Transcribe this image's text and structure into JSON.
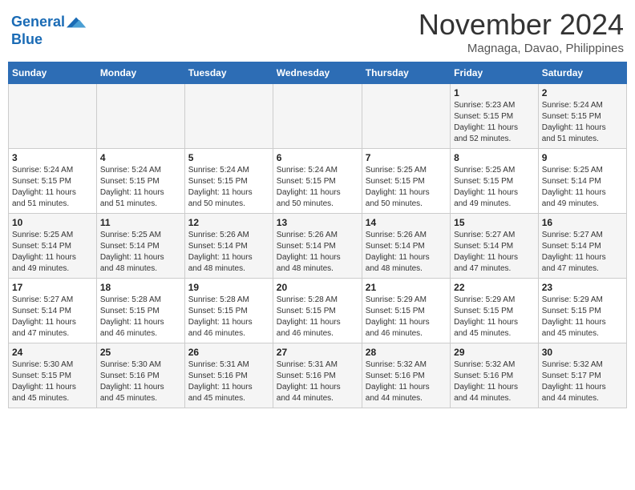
{
  "header": {
    "logo_line1": "General",
    "logo_line2": "Blue",
    "month": "November 2024",
    "location": "Magnaga, Davao, Philippines"
  },
  "weekdays": [
    "Sunday",
    "Monday",
    "Tuesday",
    "Wednesday",
    "Thursday",
    "Friday",
    "Saturday"
  ],
  "weeks": [
    [
      {
        "day": "",
        "info": ""
      },
      {
        "day": "",
        "info": ""
      },
      {
        "day": "",
        "info": ""
      },
      {
        "day": "",
        "info": ""
      },
      {
        "day": "",
        "info": ""
      },
      {
        "day": "1",
        "info": "Sunrise: 5:23 AM\nSunset: 5:15 PM\nDaylight: 11 hours\nand 52 minutes."
      },
      {
        "day": "2",
        "info": "Sunrise: 5:24 AM\nSunset: 5:15 PM\nDaylight: 11 hours\nand 51 minutes."
      }
    ],
    [
      {
        "day": "3",
        "info": "Sunrise: 5:24 AM\nSunset: 5:15 PM\nDaylight: 11 hours\nand 51 minutes."
      },
      {
        "day": "4",
        "info": "Sunrise: 5:24 AM\nSunset: 5:15 PM\nDaylight: 11 hours\nand 51 minutes."
      },
      {
        "day": "5",
        "info": "Sunrise: 5:24 AM\nSunset: 5:15 PM\nDaylight: 11 hours\nand 50 minutes."
      },
      {
        "day": "6",
        "info": "Sunrise: 5:24 AM\nSunset: 5:15 PM\nDaylight: 11 hours\nand 50 minutes."
      },
      {
        "day": "7",
        "info": "Sunrise: 5:25 AM\nSunset: 5:15 PM\nDaylight: 11 hours\nand 50 minutes."
      },
      {
        "day": "8",
        "info": "Sunrise: 5:25 AM\nSunset: 5:15 PM\nDaylight: 11 hours\nand 49 minutes."
      },
      {
        "day": "9",
        "info": "Sunrise: 5:25 AM\nSunset: 5:14 PM\nDaylight: 11 hours\nand 49 minutes."
      }
    ],
    [
      {
        "day": "10",
        "info": "Sunrise: 5:25 AM\nSunset: 5:14 PM\nDaylight: 11 hours\nand 49 minutes."
      },
      {
        "day": "11",
        "info": "Sunrise: 5:25 AM\nSunset: 5:14 PM\nDaylight: 11 hours\nand 48 minutes."
      },
      {
        "day": "12",
        "info": "Sunrise: 5:26 AM\nSunset: 5:14 PM\nDaylight: 11 hours\nand 48 minutes."
      },
      {
        "day": "13",
        "info": "Sunrise: 5:26 AM\nSunset: 5:14 PM\nDaylight: 11 hours\nand 48 minutes."
      },
      {
        "day": "14",
        "info": "Sunrise: 5:26 AM\nSunset: 5:14 PM\nDaylight: 11 hours\nand 48 minutes."
      },
      {
        "day": "15",
        "info": "Sunrise: 5:27 AM\nSunset: 5:14 PM\nDaylight: 11 hours\nand 47 minutes."
      },
      {
        "day": "16",
        "info": "Sunrise: 5:27 AM\nSunset: 5:14 PM\nDaylight: 11 hours\nand 47 minutes."
      }
    ],
    [
      {
        "day": "17",
        "info": "Sunrise: 5:27 AM\nSunset: 5:14 PM\nDaylight: 11 hours\nand 47 minutes."
      },
      {
        "day": "18",
        "info": "Sunrise: 5:28 AM\nSunset: 5:15 PM\nDaylight: 11 hours\nand 46 minutes."
      },
      {
        "day": "19",
        "info": "Sunrise: 5:28 AM\nSunset: 5:15 PM\nDaylight: 11 hours\nand 46 minutes."
      },
      {
        "day": "20",
        "info": "Sunrise: 5:28 AM\nSunset: 5:15 PM\nDaylight: 11 hours\nand 46 minutes."
      },
      {
        "day": "21",
        "info": "Sunrise: 5:29 AM\nSunset: 5:15 PM\nDaylight: 11 hours\nand 46 minutes."
      },
      {
        "day": "22",
        "info": "Sunrise: 5:29 AM\nSunset: 5:15 PM\nDaylight: 11 hours\nand 45 minutes."
      },
      {
        "day": "23",
        "info": "Sunrise: 5:29 AM\nSunset: 5:15 PM\nDaylight: 11 hours\nand 45 minutes."
      }
    ],
    [
      {
        "day": "24",
        "info": "Sunrise: 5:30 AM\nSunset: 5:15 PM\nDaylight: 11 hours\nand 45 minutes."
      },
      {
        "day": "25",
        "info": "Sunrise: 5:30 AM\nSunset: 5:16 PM\nDaylight: 11 hours\nand 45 minutes."
      },
      {
        "day": "26",
        "info": "Sunrise: 5:31 AM\nSunset: 5:16 PM\nDaylight: 11 hours\nand 45 minutes."
      },
      {
        "day": "27",
        "info": "Sunrise: 5:31 AM\nSunset: 5:16 PM\nDaylight: 11 hours\nand 44 minutes."
      },
      {
        "day": "28",
        "info": "Sunrise: 5:32 AM\nSunset: 5:16 PM\nDaylight: 11 hours\nand 44 minutes."
      },
      {
        "day": "29",
        "info": "Sunrise: 5:32 AM\nSunset: 5:16 PM\nDaylight: 11 hours\nand 44 minutes."
      },
      {
        "day": "30",
        "info": "Sunrise: 5:32 AM\nSunset: 5:17 PM\nDaylight: 11 hours\nand 44 minutes."
      }
    ]
  ]
}
